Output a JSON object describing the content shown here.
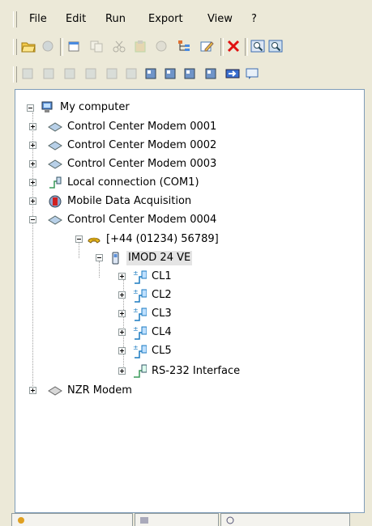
{
  "menu": {
    "items": [
      "File",
      "Edit",
      "Run",
      "Export",
      "View",
      "?"
    ]
  },
  "toolbar1": {
    "buttons": [
      "open-folder-icon",
      "connect-icon",
      "new-item-icon",
      "copy-icon",
      "cut-icon",
      "paste-icon",
      "properties-icon",
      "tree-icon",
      "edit-icon",
      "delete-icon",
      "zoom-icon",
      "zoom-all-icon"
    ]
  },
  "toolbar2": {
    "buttons": [
      "f1-icon",
      "f2-icon",
      "f3-icon",
      "f4-icon",
      "f5-icon",
      "f6-icon",
      "f7-icon",
      "f8-icon",
      "f9-icon",
      "f10-icon",
      "transfer-icon",
      "terminal-icon"
    ]
  },
  "tree": {
    "root": "My computer",
    "modem1": "Control Center Modem 0001",
    "modem2": "Control Center Modem 0002",
    "modem3": "Control Center Modem 0003",
    "local": "Local connection (COM1)",
    "mobile": "Mobile Data Acquisition",
    "modem4": "Control Center Modem 0004",
    "phone": "[+44 (01234) 56789]",
    "device": "IMOD 24 VE",
    "cl1": "CL1",
    "cl2": "CL2",
    "cl3": "CL3",
    "cl4": "CL4",
    "cl5": "CL5",
    "rs232": "RS-232 Interface",
    "nzr": "NZR Modem"
  },
  "colors": {
    "chrome": "#ece9d8",
    "panel_border": "#7f9db9",
    "selection": "#e4e4e4"
  }
}
